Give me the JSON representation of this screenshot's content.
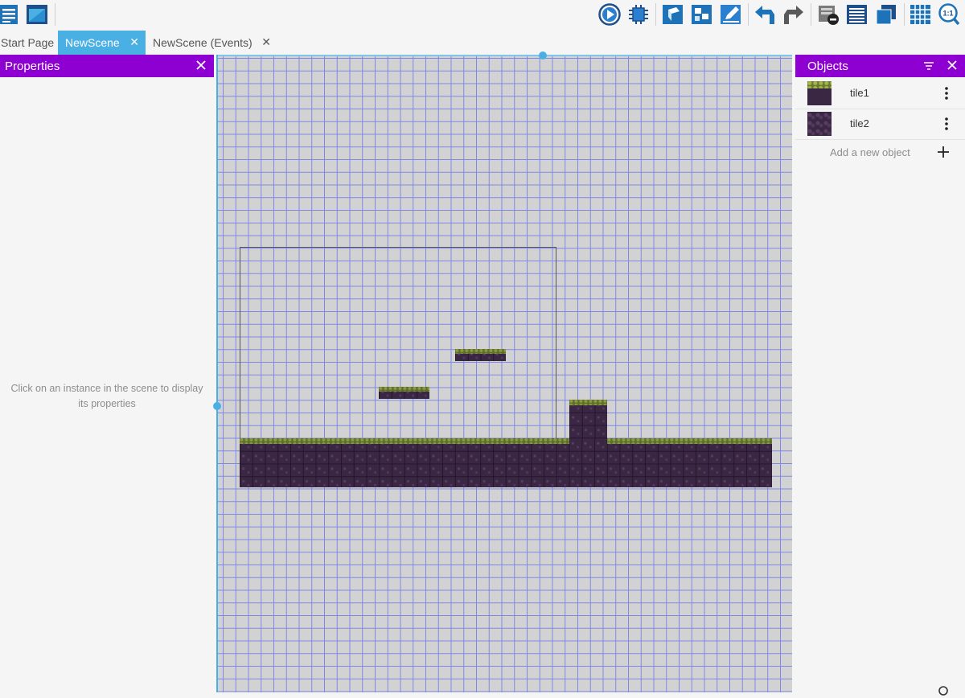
{
  "tabs": [
    {
      "label": "Start Page",
      "active": false,
      "closable": false
    },
    {
      "label": "NewScene",
      "active": true,
      "closable": true
    },
    {
      "label": "NewScene (Events)",
      "active": false,
      "closable": true
    }
  ],
  "tab_close_glyph": "✕",
  "properties": {
    "title": "Properties",
    "empty_message_line1": "Click on an instance in the scene to display",
    "empty_message_line2": "its properties"
  },
  "objects": {
    "title": "Objects",
    "items": [
      {
        "name": "tile1",
        "thumbnail": "grass-tile"
      },
      {
        "name": "tile2",
        "thumbnail": "dirt-tile"
      }
    ],
    "add_label": "Add a new object"
  },
  "toolbar_icons": [
    "project-manager-icon",
    "start-page-icon",
    "preview-icon",
    "debug-icon",
    "layers-icon",
    "instances-icon",
    "edit-object-icon",
    "undo-icon",
    "redo-icon",
    "delete-icon",
    "instances-list-icon",
    "layer-icon",
    "grid-icon",
    "zoom-reset-icon"
  ],
  "zoom_reset_label": "1:1",
  "colors": {
    "accent_purple": "#8e00d2",
    "accent_blue": "#4ab0e4",
    "canvas_bg": "#d3d2d3",
    "grid_line": "#7f87e6",
    "tile_dark": "#3a2743",
    "tile_grass": "#5e6e2e"
  }
}
